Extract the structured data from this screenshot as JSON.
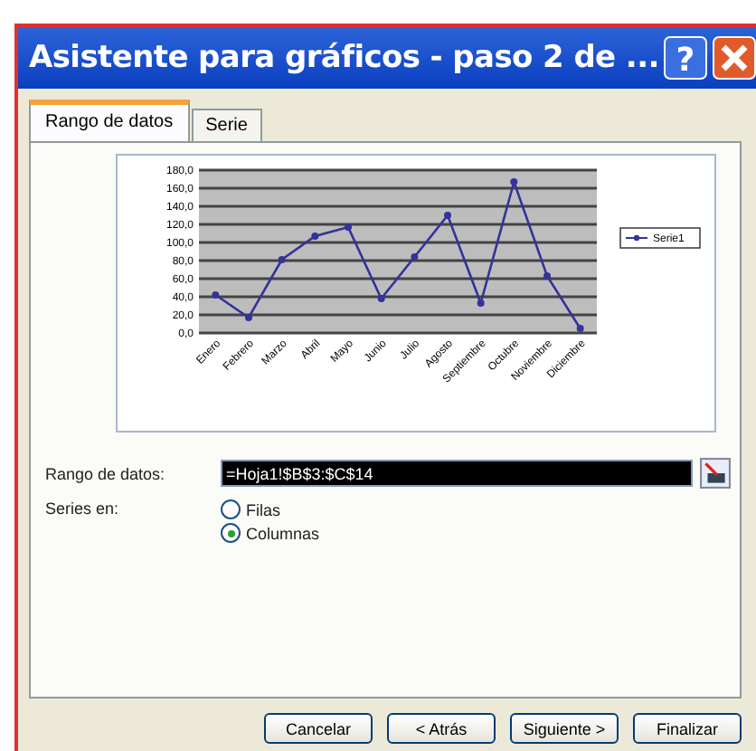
{
  "window": {
    "title": "Asistente para gráficos - paso 2 de ...",
    "help_button": "?"
  },
  "tabs": [
    {
      "label": "Rango de datos",
      "selected": true
    },
    {
      "label": "Serie",
      "selected": false
    }
  ],
  "chart_data": {
    "type": "line",
    "grid": true,
    "categories": [
      "Enero",
      "Febrero",
      "Marzo",
      "Abril",
      "Mayo",
      "Junio",
      "Julio",
      "Agosto",
      "Septiembre",
      "Octubre",
      "Noviembre",
      "Diciembre"
    ],
    "series": [
      {
        "name": "Serie1",
        "color": "#333399",
        "marker": "circle",
        "values": [
          42,
          17,
          81,
          107,
          117,
          38,
          84,
          130,
          33,
          167,
          63,
          5
        ]
      }
    ],
    "ylim": [
      0,
      180
    ],
    "yticks": [
      {
        "value": 0,
        "label": "0,0"
      },
      {
        "value": 20,
        "label": "20,0"
      },
      {
        "value": 40,
        "label": "40,0"
      },
      {
        "value": 60,
        "label": "60,0"
      },
      {
        "value": 80,
        "label": "80,0"
      },
      {
        "value": 100,
        "label": "100,0"
      },
      {
        "value": 120,
        "label": "120,0"
      },
      {
        "value": 140,
        "label": "140,0"
      },
      {
        "value": 160,
        "label": "160,0"
      },
      {
        "value": 180,
        "label": "180,0"
      }
    ]
  },
  "data_range": {
    "label": "Rango de datos:",
    "value": "=Hoja1!$B$3:$C$14"
  },
  "series_in": {
    "label": "Series en:",
    "options": [
      {
        "label": "Filas",
        "selected": false
      },
      {
        "label": "Columnas",
        "selected": true
      }
    ]
  },
  "buttons": [
    "Cancelar",
    "< Atrás",
    "Siguiente >",
    "Finalizar"
  ]
}
